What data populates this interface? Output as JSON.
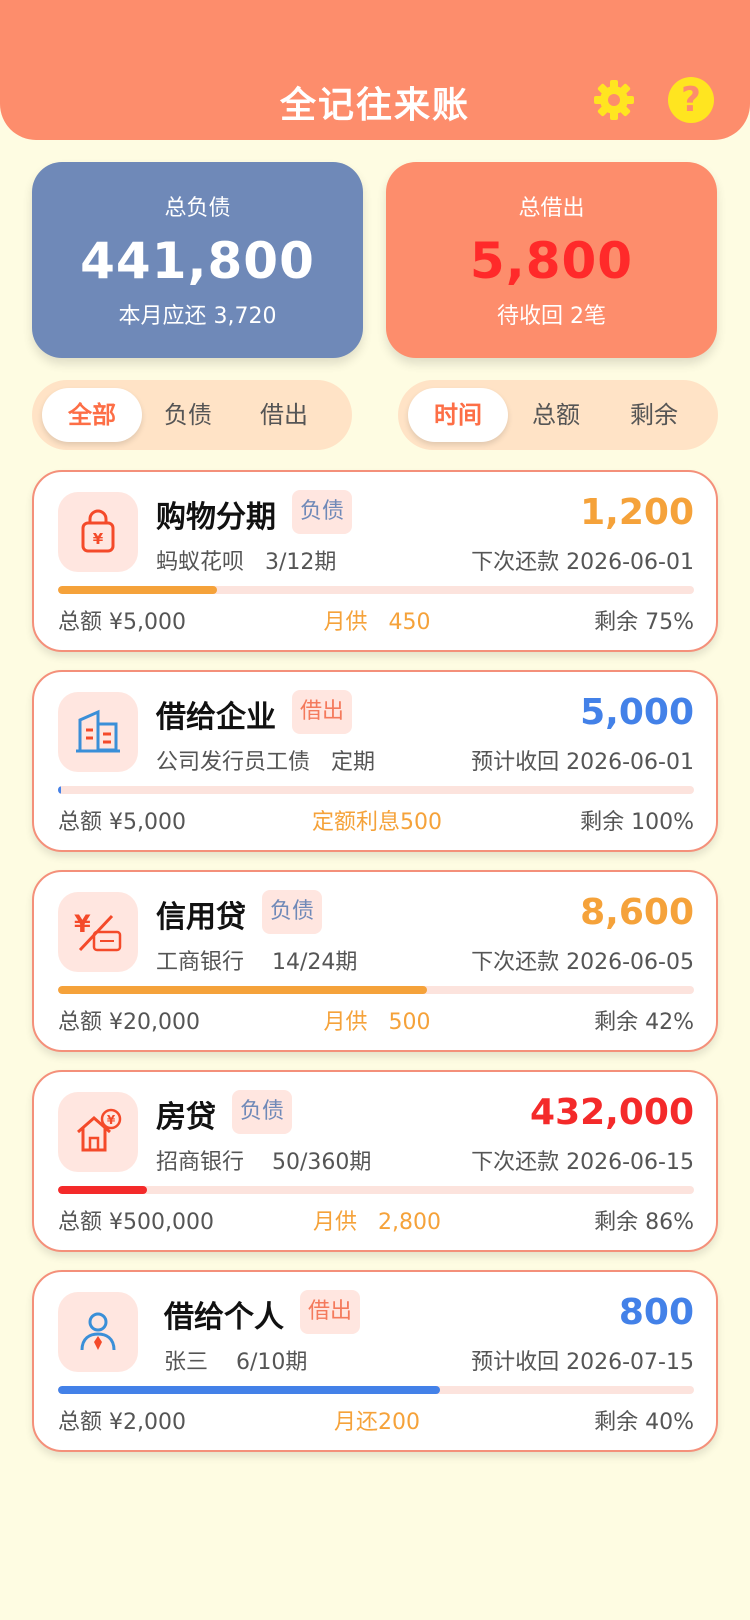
{
  "header": {
    "title": "全记往来账"
  },
  "summary": {
    "debt": {
      "label": "总负债",
      "value": "441,800",
      "sub": "本月应还 3,720"
    },
    "lend": {
      "label": "总借出",
      "value": "5,800",
      "sub": "待收回 2笔"
    }
  },
  "filter_tabs": [
    "全部",
    "负债",
    "借出"
  ],
  "sort_tabs": [
    "时间",
    "总额",
    "剩余"
  ],
  "colors": {
    "header": "#FD8D6C",
    "debt_card": "#6F89B8",
    "orange": "#F5A23A",
    "blue": "#4381E8",
    "red": "#F42A2A"
  },
  "records": [
    {
      "title": "购物分期",
      "tag": "负债",
      "amount": "1,200",
      "source": "蚂蚁花呗",
      "period": "3/12期",
      "date_label": "下次还款 2026-06-01",
      "total": "总额 ¥5,000",
      "mid_label": "月供",
      "mid_value": "450",
      "remaining": "剩余 75%",
      "progress": 0.25,
      "icon": "shopping-bag-icon"
    },
    {
      "title": "借给企业",
      "tag": "借出",
      "amount": "5,000",
      "source": "公司发行员工债",
      "period": "定期",
      "date_label": "预计收回 2026-06-01",
      "total": "总额 ¥5,000",
      "mid_label": "定额利息500",
      "mid_value": "",
      "remaining": "剩余 100%",
      "progress": 0.0,
      "icon": "building-icon"
    },
    {
      "title": "信用贷",
      "tag": "负债",
      "amount": "8,600",
      "source": "工商银行",
      "period": "14/24期",
      "date_label": "下次还款 2026-06-05",
      "total": "总额 ¥20,000",
      "mid_label": "月供",
      "mid_value": "500",
      "remaining": "剩余 42%",
      "progress": 0.58,
      "icon": "credit-card-icon"
    },
    {
      "title": "房贷",
      "tag": "负债",
      "amount": "432,000",
      "source": "招商银行",
      "period": "50/360期",
      "date_label": "下次还款 2026-06-15",
      "total": "总额 ¥500,000",
      "mid_label": "月供",
      "mid_value": "2,800",
      "remaining": "剩余 86%",
      "progress": 0.14,
      "icon": "house-icon"
    },
    {
      "title": "借给个人",
      "tag": "借出",
      "amount": "800",
      "source": "张三",
      "period": "6/10期",
      "date_label": "预计收回 2026-07-15",
      "total": "总额 ¥2,000",
      "mid_label": "月还200",
      "mid_value": "",
      "remaining": "剩余 40%",
      "progress": 0.6,
      "icon": "person-icon"
    }
  ]
}
